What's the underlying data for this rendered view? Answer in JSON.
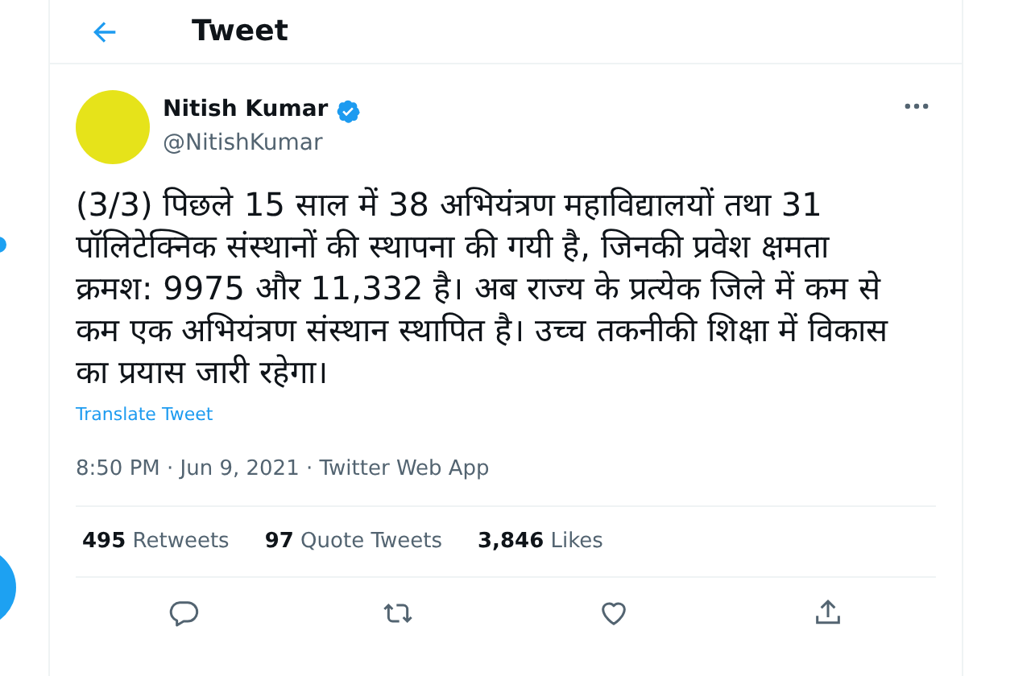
{
  "header": {
    "title": "Tweet"
  },
  "tweet": {
    "author": {
      "name": "Nitish Kumar",
      "handle": "@NitishKumar",
      "verified": true
    },
    "text": "(3/3) पिछले 15 साल में 38 अभियंत्रण महाविद्यालयों तथा 31 पॉलिटेक्निक संस्थानों की स्थापना की गयी है, जिनकी प्रवेश क्षमता क्रमश: 9975 और 11,332 है। अब राज्य के प्रत्येक जिले में कम से कम एक अभियंत्रण संस्थान स्थापित है। उच्च तकनीकी शिक्षा में विकास का प्रयास जारी रहेगा।",
    "translate_link": "Translate Tweet",
    "meta": "8:50 PM · Jun 9, 2021 · Twitter Web App",
    "stats": [
      "**495** Retweets",
      "**97** Quote Tweets",
      "**3,846** Likes"
    ],
    "actions": [
      {
        "kind": "reply"
      },
      {
        "kind": "retweet"
      },
      {
        "kind": "like"
      },
      {
        "kind": "share"
      }
    ]
  }
}
